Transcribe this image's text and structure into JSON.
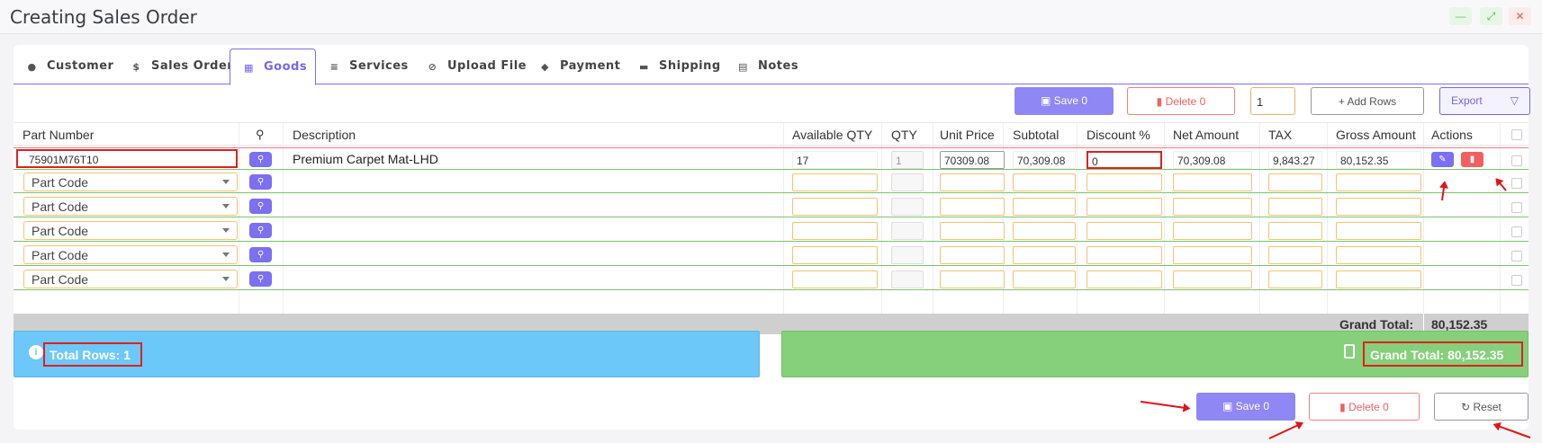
{
  "window": {
    "title": "Creating Sales Order",
    "min": "—",
    "max": "⤢",
    "close": "✕"
  },
  "tabs": [
    {
      "label": "Customer",
      "icon": "user-icon"
    },
    {
      "label": "Sales Order",
      "icon": "file-dollar-icon"
    },
    {
      "label": "Goods",
      "icon": "boxes-icon"
    },
    {
      "label": "Services",
      "icon": "file-text-icon"
    },
    {
      "label": "Upload File",
      "icon": "paperclip-icon"
    },
    {
      "label": "Payment",
      "icon": "money-bag-icon"
    },
    {
      "label": "Shipping",
      "icon": "truck-icon"
    },
    {
      "label": "Notes",
      "icon": "notebook-icon"
    }
  ],
  "toolbar": {
    "save": "Save 0",
    "delete": "Delete  0",
    "rows_count": "1",
    "add_rows": "+ Add Rows",
    "export": "Export"
  },
  "columns": [
    "Part Number",
    "Description",
    "Available QTY",
    "QTY",
    "Unit Price",
    "Subtotal",
    "Discount %",
    "Net Amount",
    "TAX",
    "Gross Amount",
    "Actions"
  ],
  "item": {
    "part_number": "75901M76T10",
    "description": "Premium Carpet Mat-LHD",
    "available_qty": "17",
    "qty": "1",
    "unit_price": "70309.08",
    "subtotal": "70,309.08",
    "discount": "0",
    "net_amount": "70,309.08",
    "tax": "9,843.27",
    "gross_amount": "80,152.35"
  },
  "empty_row_placeholder": "Part Code",
  "grand_total_label": "Grand Total:",
  "grand_total_value": "80,152.35",
  "summary": {
    "total_rows": "Total Rows: 1",
    "grand_total": "Grand Total: 80,152.35"
  },
  "footer": {
    "save": "Save 0",
    "delete": "Delete  0",
    "reset": "Reset"
  },
  "colors": {
    "accent": "#7367f0",
    "info": "#6cc8f8",
    "success": "#86cf7b",
    "danger": "#f06060",
    "annotation": "#e02020"
  }
}
